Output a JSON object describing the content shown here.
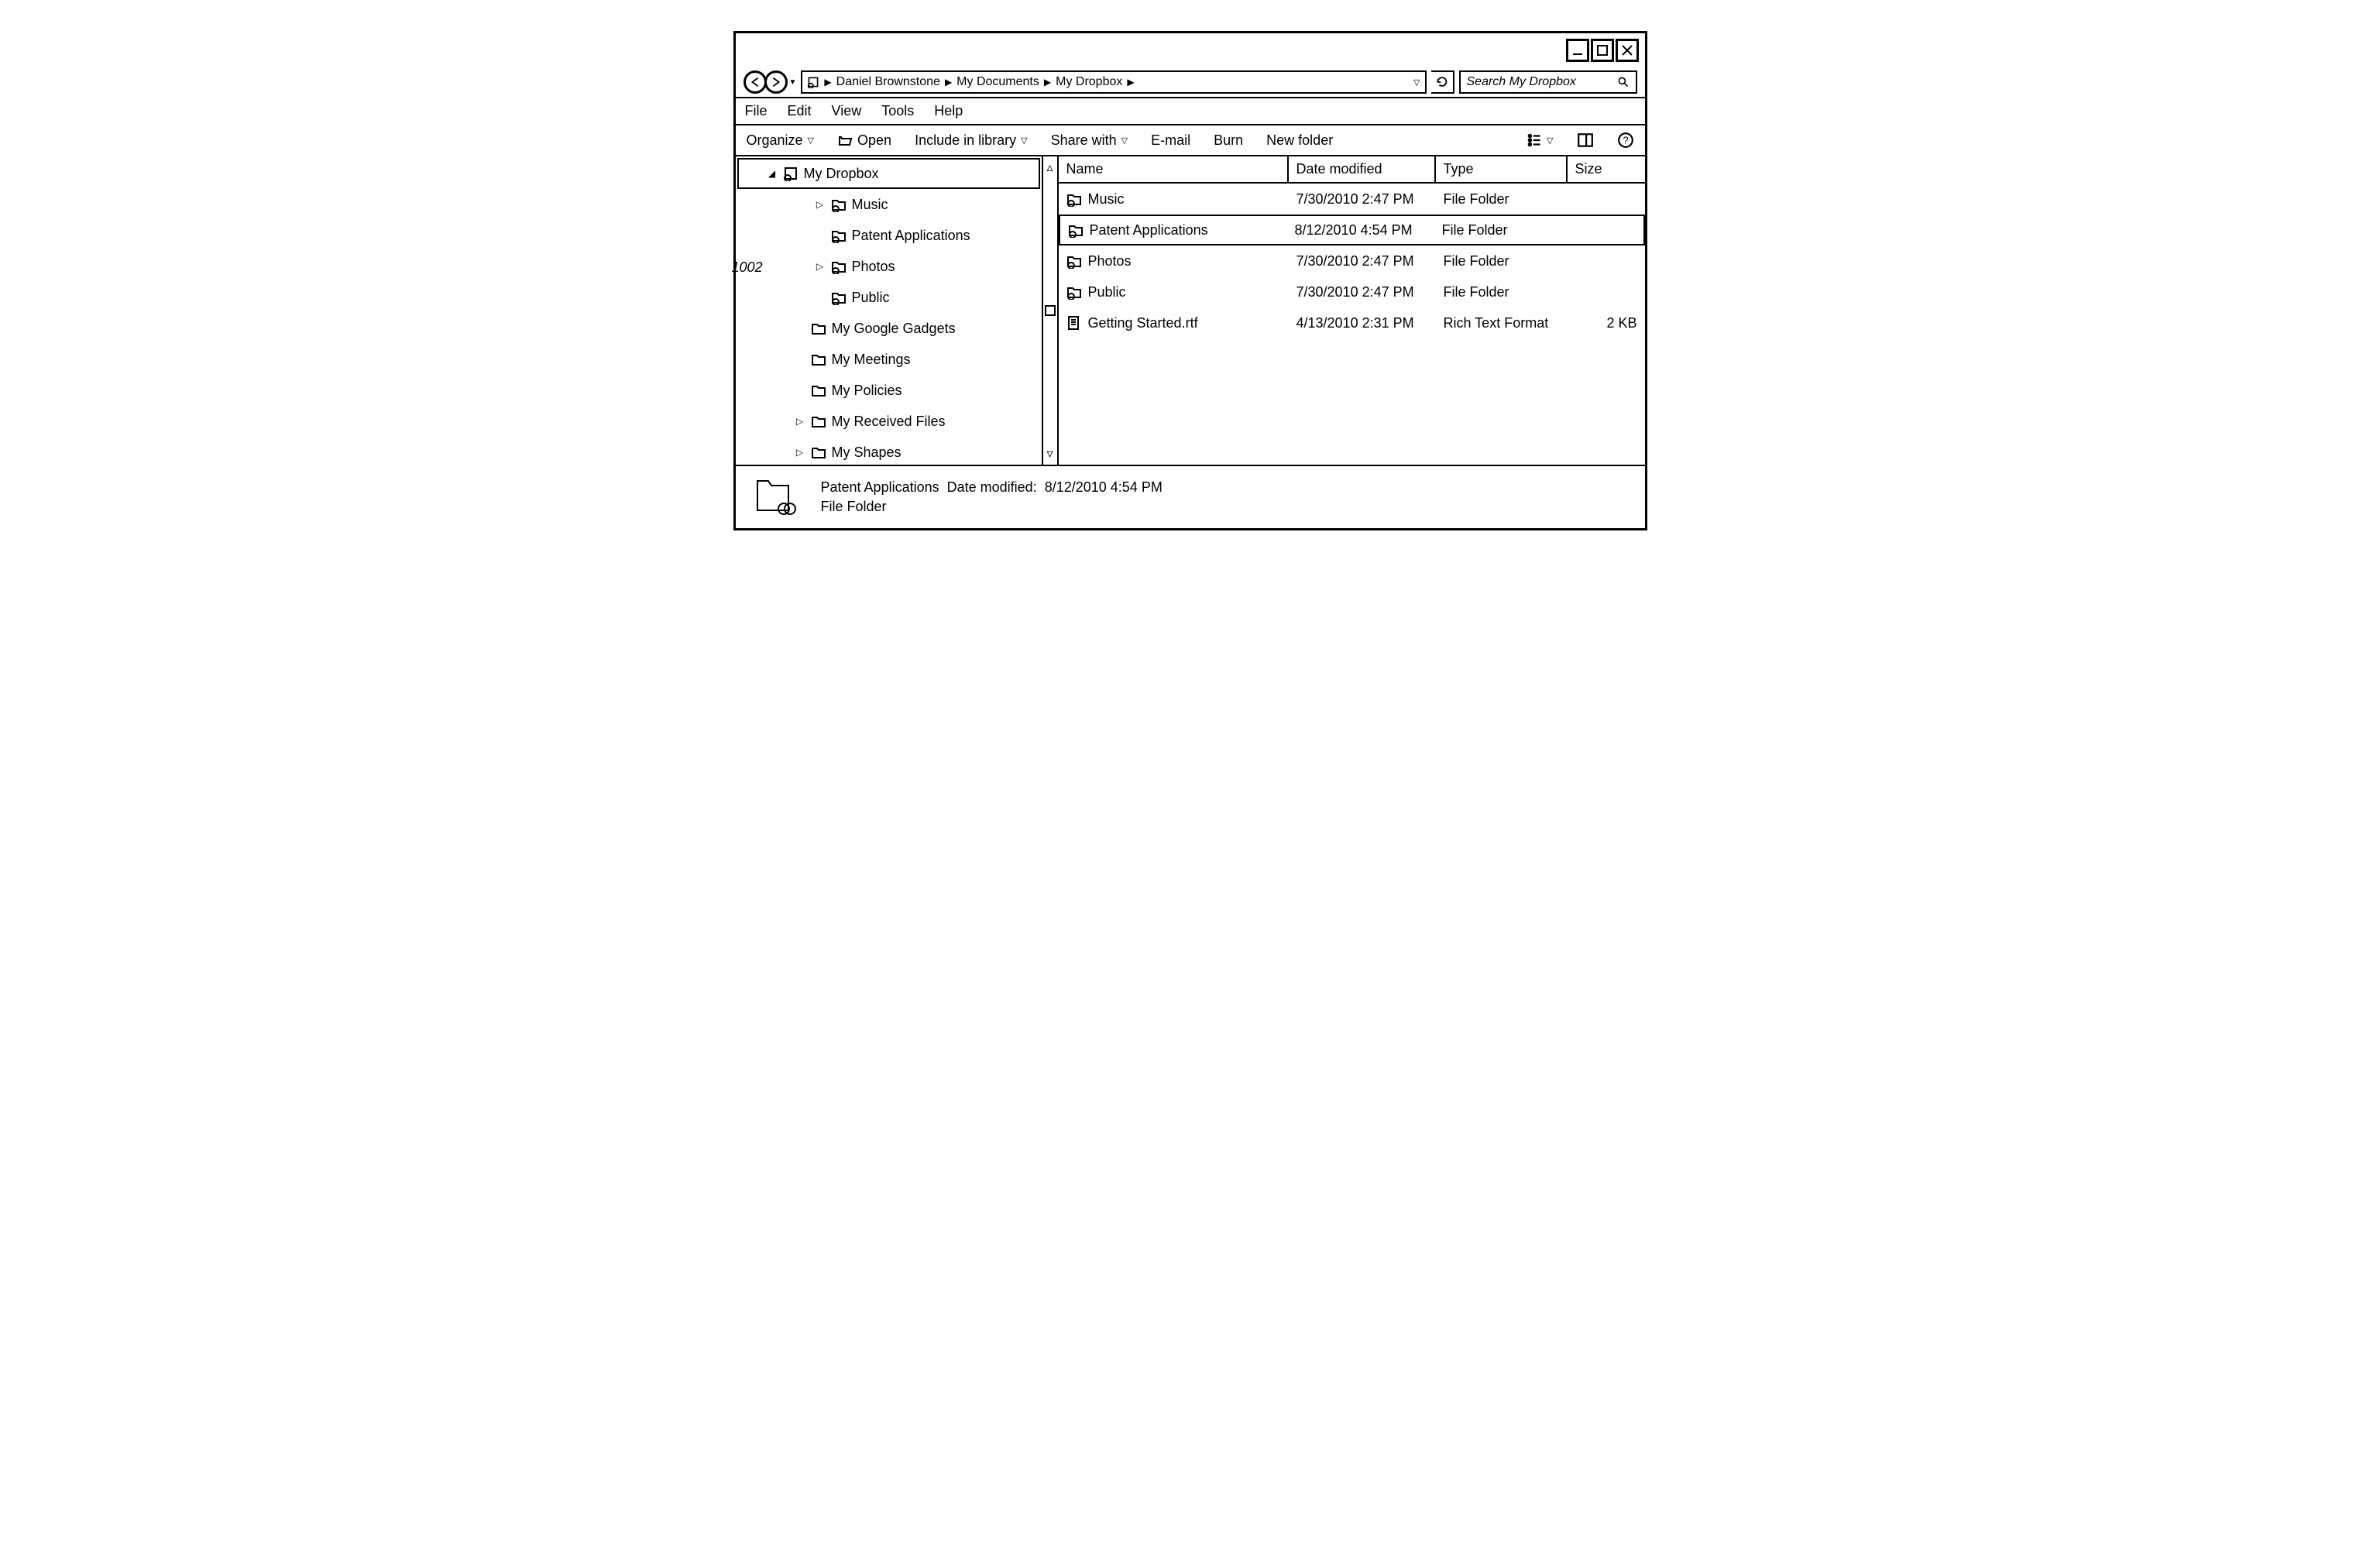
{
  "callout": "1002",
  "breadcrumb": {
    "segments": [
      "Daniel Brownstone",
      "My Documents",
      "My Dropbox"
    ]
  },
  "search": {
    "placeholder": "Search My Dropbox"
  },
  "menubar": [
    "File",
    "Edit",
    "View",
    "Tools",
    "Help"
  ],
  "toolbar": {
    "organize": "Organize",
    "open": "Open",
    "include": "Include in library",
    "share": "Share with",
    "email": "E-mail",
    "burn": "Burn",
    "newfolder": "New folder"
  },
  "columns": {
    "name": "Name",
    "date": "Date modified",
    "type": "Type",
    "size": "Size"
  },
  "tree": {
    "items": [
      {
        "label": "My Dropbox",
        "indent": 0,
        "toggle": "open",
        "icon": "dropbox",
        "selected": true
      },
      {
        "label": "Music",
        "indent": 1,
        "toggle": "closed",
        "icon": "sync-folder"
      },
      {
        "label": "Patent Applications",
        "indent": 1,
        "toggle": "",
        "icon": "sync-folder"
      },
      {
        "label": "Photos",
        "indent": 1,
        "toggle": "closed",
        "icon": "sync-folder"
      },
      {
        "label": "Public",
        "indent": 1,
        "toggle": "",
        "icon": "sync-folder"
      },
      {
        "label": "My Google Gadgets",
        "indent": 0,
        "toggle": "",
        "icon": "folder"
      },
      {
        "label": "My Meetings",
        "indent": 0,
        "toggle": "",
        "icon": "folder"
      },
      {
        "label": "My Policies",
        "indent": 0,
        "toggle": "",
        "icon": "folder"
      },
      {
        "label": "My Received Files",
        "indent": 0,
        "toggle": "closed",
        "icon": "folder"
      },
      {
        "label": "My Shapes",
        "indent": 0,
        "toggle": "closed",
        "icon": "folder"
      }
    ]
  },
  "files": [
    {
      "name": "Music",
      "date": "7/30/2010 2:47 PM",
      "type": "File Folder",
      "size": "",
      "icon": "sync-folder"
    },
    {
      "name": "Patent Applications",
      "date": "8/12/2010 4:54 PM",
      "type": "File Folder",
      "size": "",
      "icon": "sync-folder",
      "selected": true
    },
    {
      "name": "Photos",
      "date": "7/30/2010 2:47 PM",
      "type": "File Folder",
      "size": "",
      "icon": "sync-folder"
    },
    {
      "name": "Public",
      "date": "7/30/2010 2:47 PM",
      "type": "File Folder",
      "size": "",
      "icon": "sync-folder"
    },
    {
      "name": "Getting Started.rtf",
      "date": "4/13/2010 2:31 PM",
      "type": "Rich Text Format",
      "size": "2 KB",
      "icon": "rtf"
    }
  ],
  "details": {
    "name": "Patent Applications",
    "date_label": "Date modified:",
    "date": "8/12/2010 4:54 PM",
    "type": "File Folder"
  }
}
